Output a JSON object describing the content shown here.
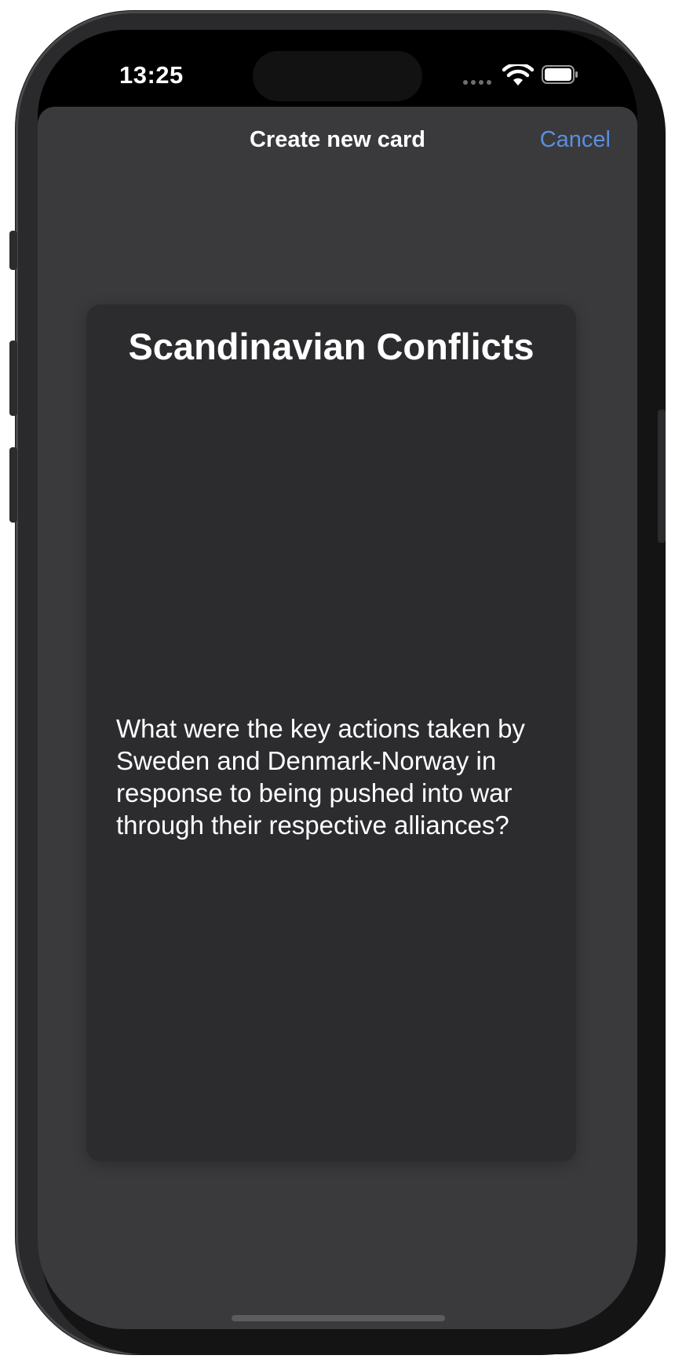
{
  "status_bar": {
    "time": "13:25"
  },
  "nav": {
    "title": "Create new card",
    "cancel_label": "Cancel"
  },
  "card": {
    "title": "Scandinavian Conflicts",
    "question": "What were the key actions taken by Sweden and Denmark-Norway in response to being pushed into war through their respective alliances?"
  },
  "icons": {
    "signal": "cellular-signal-icon",
    "wifi": "wifi-icon",
    "battery": "battery-icon"
  },
  "colors": {
    "accent": "#5a8fe0",
    "sheet_background": "#3a3a3c",
    "card_background": "#2c2c2e"
  }
}
